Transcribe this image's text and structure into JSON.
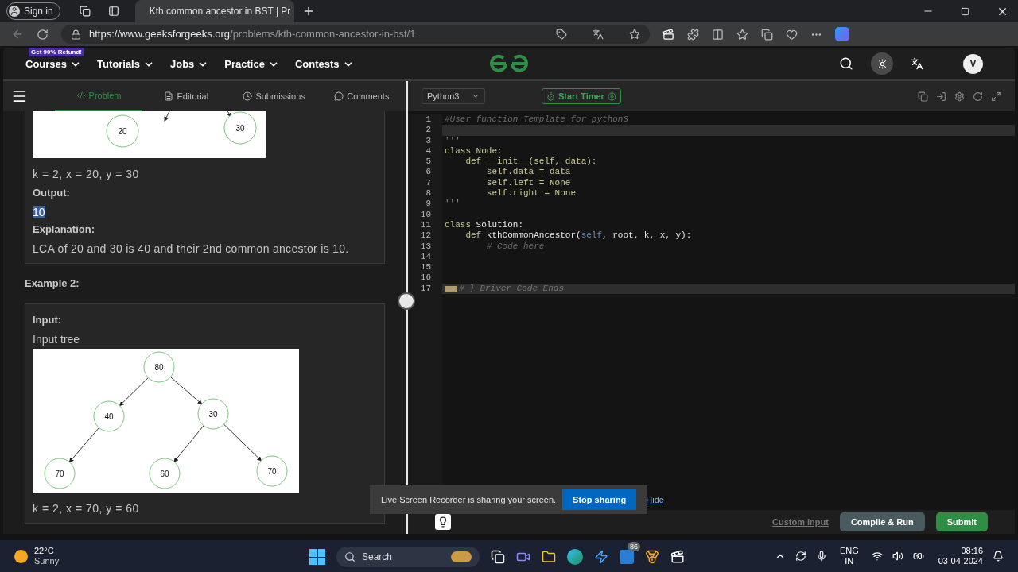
{
  "browser": {
    "sign_in": "Sign in",
    "tab_title": "Kth common ancestor in BST | Pr",
    "url_host": "https://www.geeksforgeeks.org",
    "url_path": "/problems/kth-common-ancestor-in-bst/1"
  },
  "nav": {
    "promo": "Get 90% Refund!",
    "items": [
      "Courses",
      "Tutorials",
      "Jobs",
      "Practice",
      "Contests"
    ],
    "avatar": "V"
  },
  "tabs": [
    {
      "label": "Problem",
      "selected": true,
      "kind": "code"
    },
    {
      "label": "Editorial",
      "selected": false,
      "kind": "doc"
    },
    {
      "label": "Submissions",
      "selected": false,
      "kind": "clock"
    },
    {
      "label": "Comments",
      "selected": false,
      "kind": "chat"
    }
  ],
  "example1": {
    "tree_nodes": [
      {
        "value": "20"
      },
      {
        "value": "30"
      }
    ],
    "input_line": "k = 2, x = 20, y = 30",
    "output_label": "Output:",
    "output_value": "10",
    "output_selected": true,
    "explanation_label": "Explanation:",
    "explanation": "LCA of 20 and 30 is 40 and their 2nd common ancestor is 10."
  },
  "example2": {
    "heading": "Example 2:",
    "input_label": "Input:",
    "input_desc": "Input tree",
    "tree": {
      "value": "80",
      "children": [
        {
          "value": "40",
          "children": [
            {
              "value": "70"
            }
          ]
        },
        {
          "value": "30",
          "children": [
            {
              "value": "60"
            },
            {
              "value": "70"
            }
          ]
        }
      ]
    },
    "input_line": "k = 2, x = 70, y = 60"
  },
  "editor": {
    "language": "Python3",
    "timer": "Start Timer",
    "lines": [
      {
        "number": "1",
        "highlighted": false,
        "tokens": [
          {
            "kind": "comment",
            "text": "#User function Template for python3"
          }
        ]
      },
      {
        "number": "2",
        "highlighted": true
      },
      {
        "number": "3",
        "highlighted": false,
        "tokens": [
          {
            "kind": "string",
            "text": "'''"
          }
        ]
      },
      {
        "number": "4",
        "highlighted": false,
        "tokens": [
          {
            "kind": "keyword",
            "text": "class Node:"
          }
        ]
      },
      {
        "number": "5",
        "highlighted": false,
        "tokens": [
          {
            "kind": "keyword",
            "text": "    def __init__(self, data):"
          }
        ]
      },
      {
        "number": "6",
        "highlighted": false,
        "tokens": [
          {
            "kind": "keyword",
            "text": "        self.data = data"
          }
        ]
      },
      {
        "number": "7",
        "highlighted": false,
        "tokens": [
          {
            "kind": "keyword",
            "text": "        self.left = None"
          }
        ]
      },
      {
        "number": "8",
        "highlighted": false,
        "tokens": [
          {
            "kind": "keyword",
            "text": "        self.right = None"
          }
        ]
      },
      {
        "number": "9",
        "highlighted": false,
        "tokens": [
          {
            "kind": "string",
            "text": "'''"
          }
        ]
      },
      {
        "number": "10",
        "highlighted": false
      },
      {
        "number": "11",
        "highlighted": false,
        "tokens": [
          {
            "kind": "keyword",
            "text": "class "
          },
          {
            "kind": "name",
            "text": "Solution:"
          }
        ]
      },
      {
        "number": "12",
        "highlighted": false,
        "tokens": [
          {
            "kind": "keyword",
            "text": "    def "
          },
          {
            "kind": "name",
            "text": "kthCommonAncestor("
          },
          {
            "kind": "self",
            "text": "self"
          },
          {
            "kind": "name",
            "text": ", root, k, x, y):"
          }
        ]
      },
      {
        "number": "13",
        "highlighted": false,
        "tokens": [
          {
            "kind": "comment",
            "text": "        # Code here"
          }
        ]
      },
      {
        "number": "14",
        "highlighted": false
      },
      {
        "number": "15",
        "highlighted": false
      },
      {
        "number": "16",
        "highlighted": false
      },
      {
        "number": "17",
        "highlighted": true,
        "folded": true,
        "tokens": [
          {
            "kind": "faint",
            "text": "# } Driver Code Ends"
          }
        ]
      }
    ]
  },
  "toast": {
    "message": "Live Screen Recorder is sharing your screen.",
    "stop": "Stop sharing",
    "hide": "Hide"
  },
  "footer": {
    "custom_input": "Custom Input",
    "compile": "Compile & Run",
    "submit": "Submit"
  },
  "taskbar": {
    "temperature": "22°C",
    "weather": "Sunny",
    "search": "Search",
    "badge": "86",
    "language": "ENG",
    "region": "IN",
    "time": "08:16",
    "date": "03-04-2024"
  }
}
